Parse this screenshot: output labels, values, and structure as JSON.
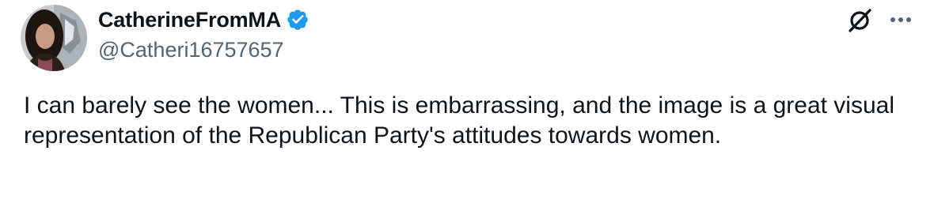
{
  "author": {
    "display_name": "CatherineFromMA",
    "handle": "@Catheri16757657",
    "verified": true
  },
  "tweet": {
    "text": "I can barely see the women... This is embarrassing, and the image is a great visual representation of the Republican Party's attitudes towards women."
  },
  "icons": {
    "verified": "verified-badge-icon",
    "grok": "grok-icon",
    "more": "more-horizontal-icon"
  },
  "colors": {
    "verified_blue": "#1d9bf0",
    "handle_gray": "#536471",
    "text": "#0f1419"
  }
}
